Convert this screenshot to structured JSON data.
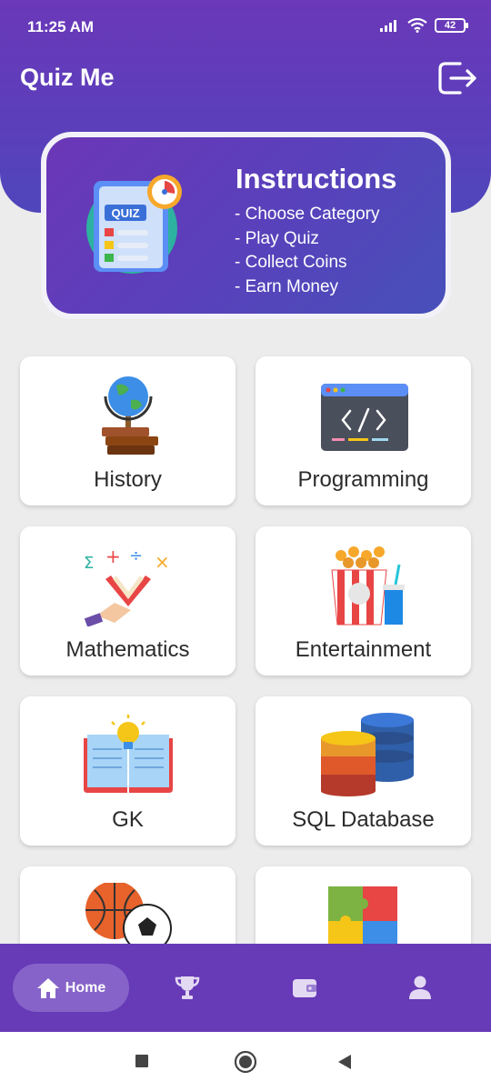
{
  "status_bar": {
    "time": "11:25 AM",
    "battery": "42"
  },
  "app": {
    "title": "Quiz Me"
  },
  "instructions": {
    "image_label": "QUIZ",
    "title": "Instructions",
    "items": [
      "- Choose Category",
      "- Play Quiz",
      "- Collect Coins",
      "- Earn Money"
    ]
  },
  "categories": [
    {
      "label": "History",
      "icon": "globe-books-icon"
    },
    {
      "label": "Programming",
      "icon": "code-window-icon"
    },
    {
      "label": "Mathematics",
      "icon": "math-book-icon"
    },
    {
      "label": "Entertainment",
      "icon": "popcorn-soda-icon"
    },
    {
      "label": "GK",
      "icon": "book-lightbulb-icon"
    },
    {
      "label": "SQL Database",
      "icon": "database-icon"
    },
    {
      "label": "",
      "icon": "sports-balls-icon"
    },
    {
      "label": "",
      "icon": "puzzle-icon"
    }
  ],
  "bottom_nav": {
    "home_label": "Home",
    "items": [
      "home-icon",
      "trophy-icon",
      "wallet-icon",
      "profile-icon"
    ]
  },
  "colors": {
    "primary": "#673ab7",
    "accent_blue": "#4750ba",
    "background": "#ececec"
  }
}
